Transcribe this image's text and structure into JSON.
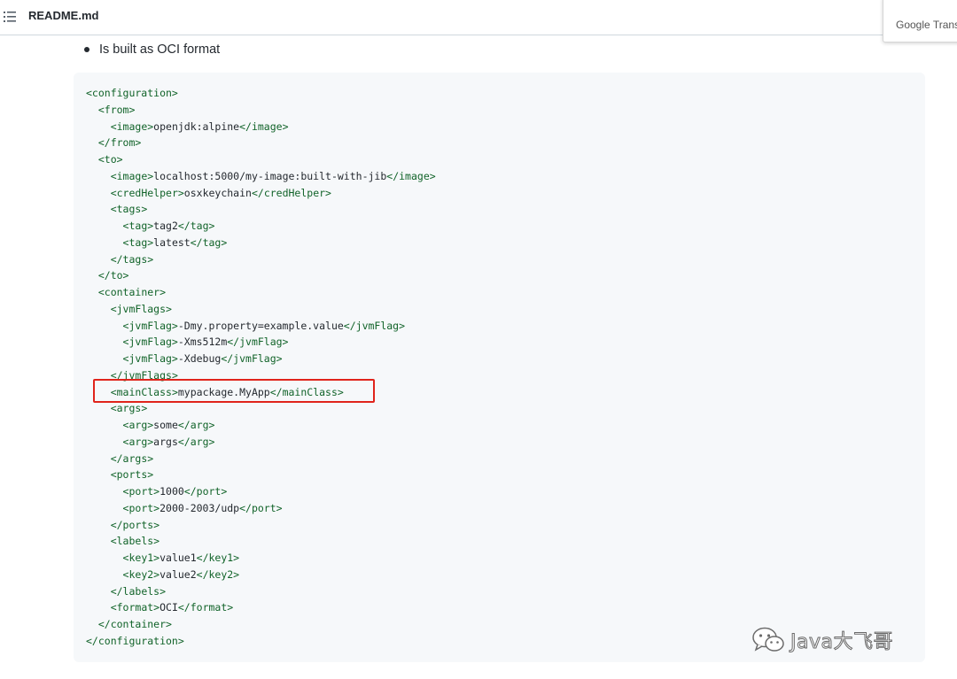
{
  "header": {
    "file_name": "README.md",
    "translate_label": "Google Translate"
  },
  "content": {
    "bullet": "Is built as OCI format",
    "code_lines": [
      {
        "indent": "",
        "parts": [
          [
            "tag",
            "<configuration>"
          ]
        ]
      },
      {
        "indent": "  ",
        "parts": [
          [
            "tag",
            "<from>"
          ]
        ]
      },
      {
        "indent": "    ",
        "parts": [
          [
            "tag",
            "<image>"
          ],
          [
            "txt",
            "openjdk:alpine"
          ],
          [
            "tag",
            "</image>"
          ]
        ]
      },
      {
        "indent": "  ",
        "parts": [
          [
            "tag",
            "</from>"
          ]
        ]
      },
      {
        "indent": "  ",
        "parts": [
          [
            "tag",
            "<to>"
          ]
        ]
      },
      {
        "indent": "    ",
        "parts": [
          [
            "tag",
            "<image>"
          ],
          [
            "txt",
            "localhost:5000/my-image:built-with-jib"
          ],
          [
            "tag",
            "</image>"
          ]
        ]
      },
      {
        "indent": "    ",
        "parts": [
          [
            "tag",
            "<credHelper>"
          ],
          [
            "txt",
            "osxkeychain"
          ],
          [
            "tag",
            "</credHelper>"
          ]
        ]
      },
      {
        "indent": "    ",
        "parts": [
          [
            "tag",
            "<tags>"
          ]
        ]
      },
      {
        "indent": "      ",
        "parts": [
          [
            "tag",
            "<tag>"
          ],
          [
            "txt",
            "tag2"
          ],
          [
            "tag",
            "</tag>"
          ]
        ]
      },
      {
        "indent": "      ",
        "parts": [
          [
            "tag",
            "<tag>"
          ],
          [
            "txt",
            "latest"
          ],
          [
            "tag",
            "</tag>"
          ]
        ]
      },
      {
        "indent": "    ",
        "parts": [
          [
            "tag",
            "</tags>"
          ]
        ]
      },
      {
        "indent": "  ",
        "parts": [
          [
            "tag",
            "</to>"
          ]
        ]
      },
      {
        "indent": "  ",
        "parts": [
          [
            "tag",
            "<container>"
          ]
        ]
      },
      {
        "indent": "    ",
        "parts": [
          [
            "tag",
            "<jvmFlags>"
          ]
        ]
      },
      {
        "indent": "      ",
        "parts": [
          [
            "tag",
            "<jvmFlag>"
          ],
          [
            "txt",
            "-Dmy.property=example.value"
          ],
          [
            "tag",
            "</jvmFlag>"
          ]
        ]
      },
      {
        "indent": "      ",
        "parts": [
          [
            "tag",
            "<jvmFlag>"
          ],
          [
            "txt",
            "-Xms512m"
          ],
          [
            "tag",
            "</jvmFlag>"
          ]
        ]
      },
      {
        "indent": "      ",
        "parts": [
          [
            "tag",
            "<jvmFlag>"
          ],
          [
            "txt",
            "-Xdebug"
          ],
          [
            "tag",
            "</jvmFlag>"
          ]
        ]
      },
      {
        "indent": "    ",
        "parts": [
          [
            "tag",
            "</jvmFlags>"
          ]
        ]
      },
      {
        "indent": "    ",
        "parts": [
          [
            "tag",
            "<mainClass>"
          ],
          [
            "txt",
            "mypackage.MyApp"
          ],
          [
            "tag",
            "</mainClass>"
          ]
        ]
      },
      {
        "indent": "    ",
        "parts": [
          [
            "tag",
            "<args>"
          ]
        ]
      },
      {
        "indent": "      ",
        "parts": [
          [
            "tag",
            "<arg>"
          ],
          [
            "txt",
            "some"
          ],
          [
            "tag",
            "</arg>"
          ]
        ]
      },
      {
        "indent": "      ",
        "parts": [
          [
            "tag",
            "<arg>"
          ],
          [
            "txt",
            "args"
          ],
          [
            "tag",
            "</arg>"
          ]
        ]
      },
      {
        "indent": "    ",
        "parts": [
          [
            "tag",
            "</args>"
          ]
        ]
      },
      {
        "indent": "    ",
        "parts": [
          [
            "tag",
            "<ports>"
          ]
        ]
      },
      {
        "indent": "      ",
        "parts": [
          [
            "tag",
            "<port>"
          ],
          [
            "txt",
            "1000"
          ],
          [
            "tag",
            "</port>"
          ]
        ]
      },
      {
        "indent": "      ",
        "parts": [
          [
            "tag",
            "<port>"
          ],
          [
            "txt",
            "2000-2003/udp"
          ],
          [
            "tag",
            "</port>"
          ]
        ]
      },
      {
        "indent": "    ",
        "parts": [
          [
            "tag",
            "</ports>"
          ]
        ]
      },
      {
        "indent": "    ",
        "parts": [
          [
            "tag",
            "<labels>"
          ]
        ]
      },
      {
        "indent": "      ",
        "parts": [
          [
            "tag",
            "<key1>"
          ],
          [
            "txt",
            "value1"
          ],
          [
            "tag",
            "</key1>"
          ]
        ]
      },
      {
        "indent": "      ",
        "parts": [
          [
            "tag",
            "<key2>"
          ],
          [
            "txt",
            "value2"
          ],
          [
            "tag",
            "</key2>"
          ]
        ]
      },
      {
        "indent": "    ",
        "parts": [
          [
            "tag",
            "</labels>"
          ]
        ]
      },
      {
        "indent": "    ",
        "parts": [
          [
            "tag",
            "<format>"
          ],
          [
            "txt",
            "OCI"
          ],
          [
            "tag",
            "</format>"
          ]
        ]
      },
      {
        "indent": "  ",
        "parts": [
          [
            "tag",
            "</container>"
          ]
        ]
      },
      {
        "indent": "",
        "parts": [
          [
            "tag",
            "</configuration>"
          ]
        ]
      }
    ]
  },
  "watermark": {
    "text": "Java大飞哥",
    "icon": "wechat-icon"
  },
  "colors": {
    "tag": "#116329",
    "text": "#24292f",
    "code_bg": "#f6f8fa",
    "highlight": "#e0241b"
  }
}
